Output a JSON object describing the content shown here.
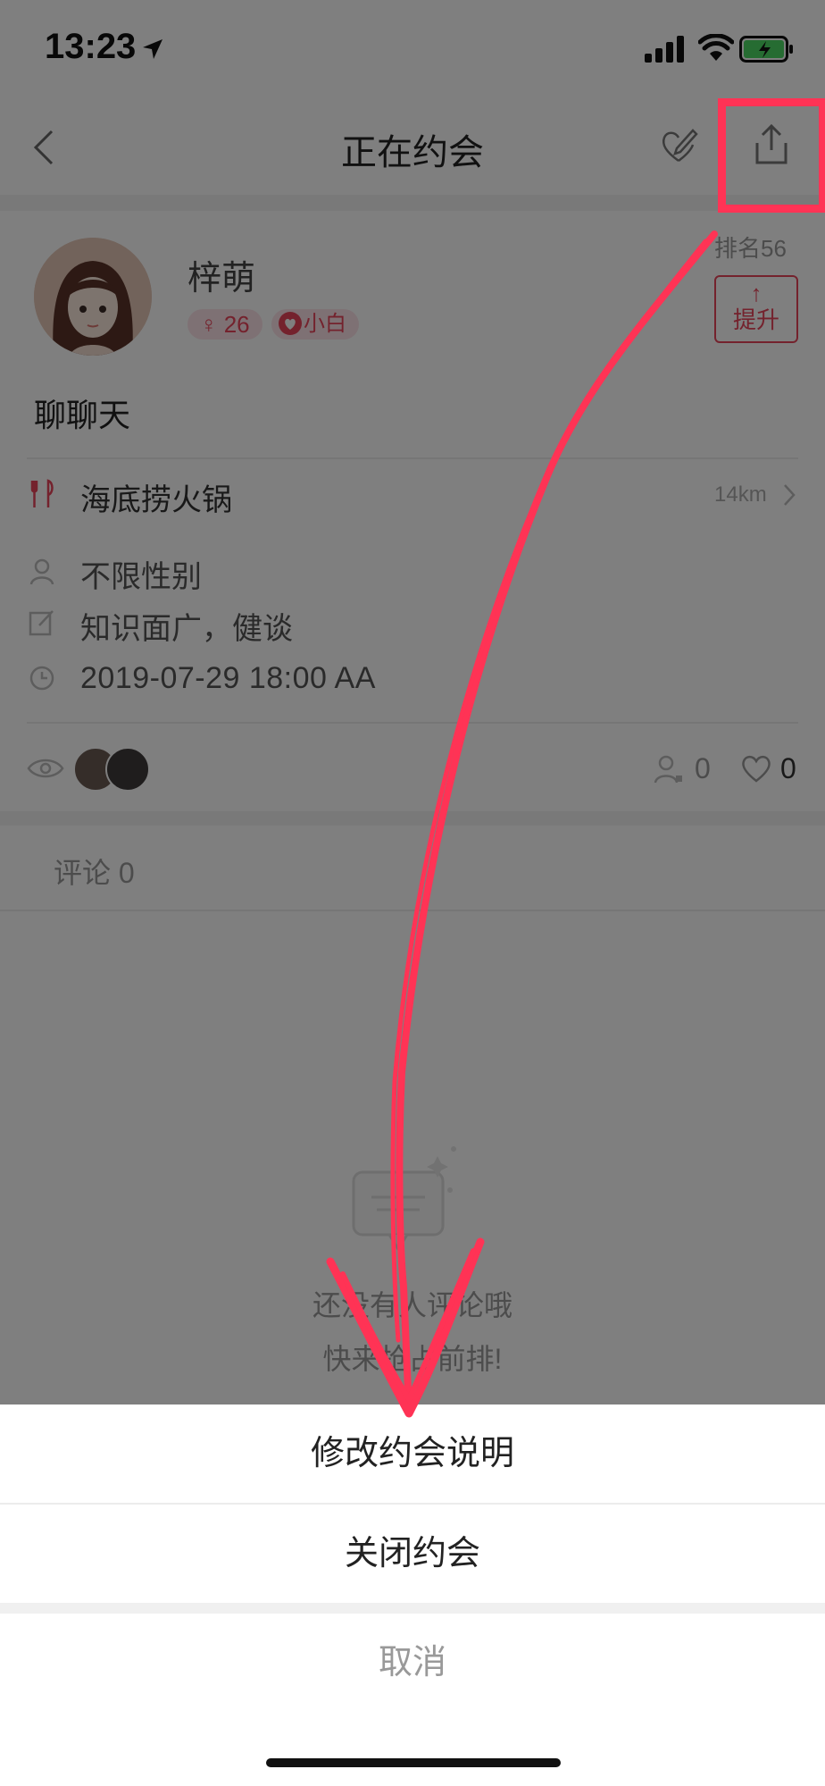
{
  "status_bar": {
    "time": "13:23",
    "icons": [
      "location-arrow-icon",
      "signal-icon",
      "wifi-icon",
      "battery-charging-icon"
    ]
  },
  "nav": {
    "title": "正在约会",
    "icons": [
      "back-icon",
      "edit-icon",
      "share-icon"
    ]
  },
  "profile": {
    "name": "梓萌",
    "age_badge": "♀ 26",
    "level_badge": "小白",
    "rank": "排名56",
    "boost_arrow": "↑",
    "boost_label": "提升"
  },
  "date": {
    "topic": "聊聊天",
    "venue": "海底捞火锅",
    "distance": "14km",
    "gender": "不限性别",
    "note": "知识面广，健谈",
    "datetime": "2019-07-29  18:00 AA"
  },
  "stats": {
    "join_count": "0",
    "like_count": "0"
  },
  "comments": {
    "title": "评论 0",
    "empty_line1": "还没有人评论哦",
    "empty_line2": "快来抢占前排!"
  },
  "action_sheet": {
    "edit_label": "修改约会说明",
    "close_label": "关闭约会",
    "cancel_label": "取消"
  },
  "colors": {
    "accent": "#e8445a",
    "annotation": "#ff3355"
  }
}
